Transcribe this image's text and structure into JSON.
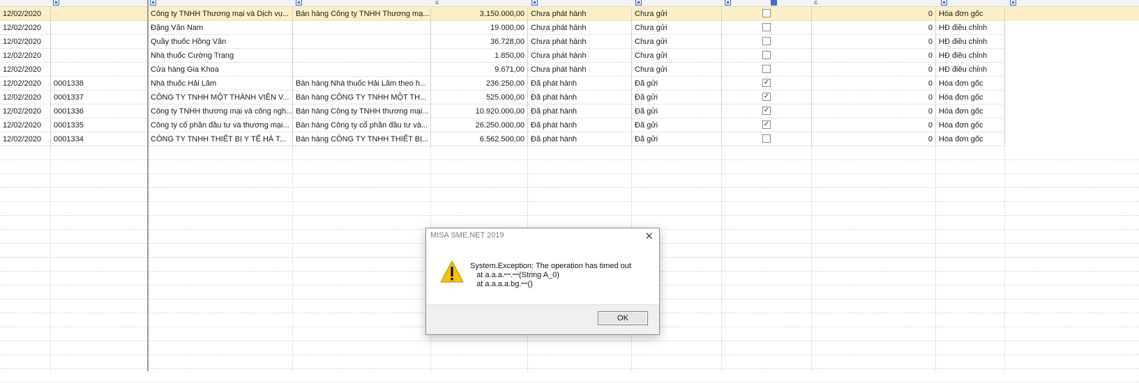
{
  "grid": {
    "rows": [
      {
        "date": "12/02/2020",
        "number": "",
        "customer": "Công ty TNHH Thương mại và Dịch vụ...",
        "description": "Bán hàng Công ty TNHH Thương mạ...",
        "amount": "3.150.000,00",
        "issue_status": "Chưa phát hành",
        "send_status": "Chưa gửi",
        "checked": false,
        "count": "0",
        "invoice_type": "Hóa đơn gốc",
        "selected": true
      },
      {
        "date": "12/02/2020",
        "number": "",
        "customer": "Đặng Văn Nam",
        "description": "",
        "amount": "19.000,00",
        "issue_status": "Chưa phát hành",
        "send_status": "Chưa gửi",
        "checked": false,
        "count": "0",
        "invoice_type": "HĐ điều chỉnh",
        "selected": false
      },
      {
        "date": "12/02/2020",
        "number": "",
        "customer": "Quầy thuốc Hồng Vân",
        "description": "",
        "amount": "36.728,00",
        "issue_status": "Chưa phát hành",
        "send_status": "Chưa gửi",
        "checked": false,
        "count": "0",
        "invoice_type": "HĐ điều chỉnh",
        "selected": false
      },
      {
        "date": "12/02/2020",
        "number": "",
        "customer": "Nhà thuốc Cường Trang",
        "description": "",
        "amount": "1.850,00",
        "issue_status": "Chưa phát hành",
        "send_status": "Chưa gửi",
        "checked": false,
        "count": "0",
        "invoice_type": "HĐ điều chỉnh",
        "selected": false
      },
      {
        "date": "12/02/2020",
        "number": "",
        "customer": "Cửa hàng Gia Khoa",
        "description": "",
        "amount": "9.671,00",
        "issue_status": "Chưa phát hành",
        "send_status": "Chưa gửi",
        "checked": false,
        "count": "0",
        "invoice_type": "HĐ điều chỉnh",
        "selected": false
      },
      {
        "date": "12/02/2020",
        "number": "0001338",
        "customer": "Nhà thuốc Hải Lâm",
        "description": "Bán hàng Nhà thuốc Hải Lâm theo h...",
        "amount": "236.250,00",
        "issue_status": "Đã phát hành",
        "send_status": "Đã gửi",
        "checked": true,
        "count": "0",
        "invoice_type": "Hóa đơn gốc",
        "selected": false
      },
      {
        "date": "12/02/2020",
        "number": "0001337",
        "customer": "CÔNG TY TNHH MỘT THÀNH VIÊN V...",
        "description": "Bán hàng CÔNG TY TNHH MỘT TH...",
        "amount": "525.000,00",
        "issue_status": "Đã phát hành",
        "send_status": "Đã gửi",
        "checked": true,
        "count": "0",
        "invoice_type": "Hóa đơn gốc",
        "selected": false
      },
      {
        "date": "12/02/2020",
        "number": "0001336",
        "customer": "Công ty TNHH thương mại và công ngh...",
        "description": "Bán hàng Công ty TNHH thương mại...",
        "amount": "10.920.000,00",
        "issue_status": "Đã phát hành",
        "send_status": "Đã gửi",
        "checked": true,
        "count": "0",
        "invoice_type": "Hóa đơn gốc",
        "selected": false
      },
      {
        "date": "12/02/2020",
        "number": "0001335",
        "customer": "Công ty cổ phần đầu tư và thương mại...",
        "description": "Bán hàng Công ty cổ phần đầu tư và...",
        "amount": "26.250.000,00",
        "issue_status": "Đã phát hành",
        "send_status": "Đã gửi",
        "checked": true,
        "count": "0",
        "invoice_type": "Hóa đơn gốc",
        "selected": false
      },
      {
        "date": "12/02/2020",
        "number": "0001334",
        "customer": "CÔNG TY TNHH THIẾT BỊ Y TẾ HÀ T...",
        "description": "Bán hàng CÔNG TY TNHH THIẾT BỊ...",
        "amount": "6.562.500,00",
        "issue_status": "Đã phát hành",
        "send_status": "Đã gửi",
        "checked": false,
        "count": "0",
        "invoice_type": "Hóa đơn gốc",
        "selected": false
      }
    ]
  },
  "dialog": {
    "title": "MISA SME.NET 2019",
    "close_symbol": "✕",
    "message_lines": [
      "System.Exception: The operation has timed out",
      "   at a.a.a.ꟷ.ꟷ(String A_0)",
      "   at a.a.a.a.bg.ꟷ()"
    ],
    "ok_label": "OK",
    "icon": "warning-icon"
  }
}
